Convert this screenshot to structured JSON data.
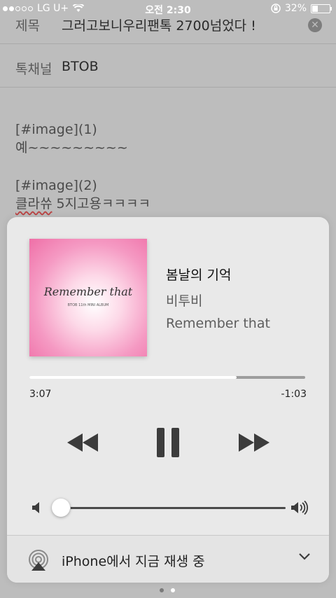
{
  "status_bar": {
    "carrier": "LG U+",
    "time": "오전 2:30",
    "battery": "32%"
  },
  "compose": {
    "subject_label": "제목",
    "subject_value": "그러고보니우리팬톡 2700넘었다 !",
    "channel_label": "톡채널",
    "channel_value": "BTOB",
    "body": [
      {
        "type": "figure",
        "text": "[#image](1)"
      },
      {
        "type": "text",
        "text": "예~~~~~~~~~"
      },
      {
        "type": "figure",
        "text": "[#image](2)"
      },
      {
        "type": "text_spell",
        "spell": "클라쓔",
        "text": " 5지고용ㅋㅋㅋㅋ"
      }
    ]
  },
  "player": {
    "album_art_text": "Remember that",
    "album_art_sub": "BTOB 11th MINI ALBUM",
    "title": "봄날의 기억",
    "artist": "비투비",
    "album": "Remember that",
    "elapsed": "3:07",
    "remaining": "-1:03",
    "progress_fraction": 0.75,
    "volume_fraction": 0.04,
    "airplay_label": "iPhone에서 지금 재생 중"
  },
  "pager": {
    "count": 2,
    "active": 1
  }
}
